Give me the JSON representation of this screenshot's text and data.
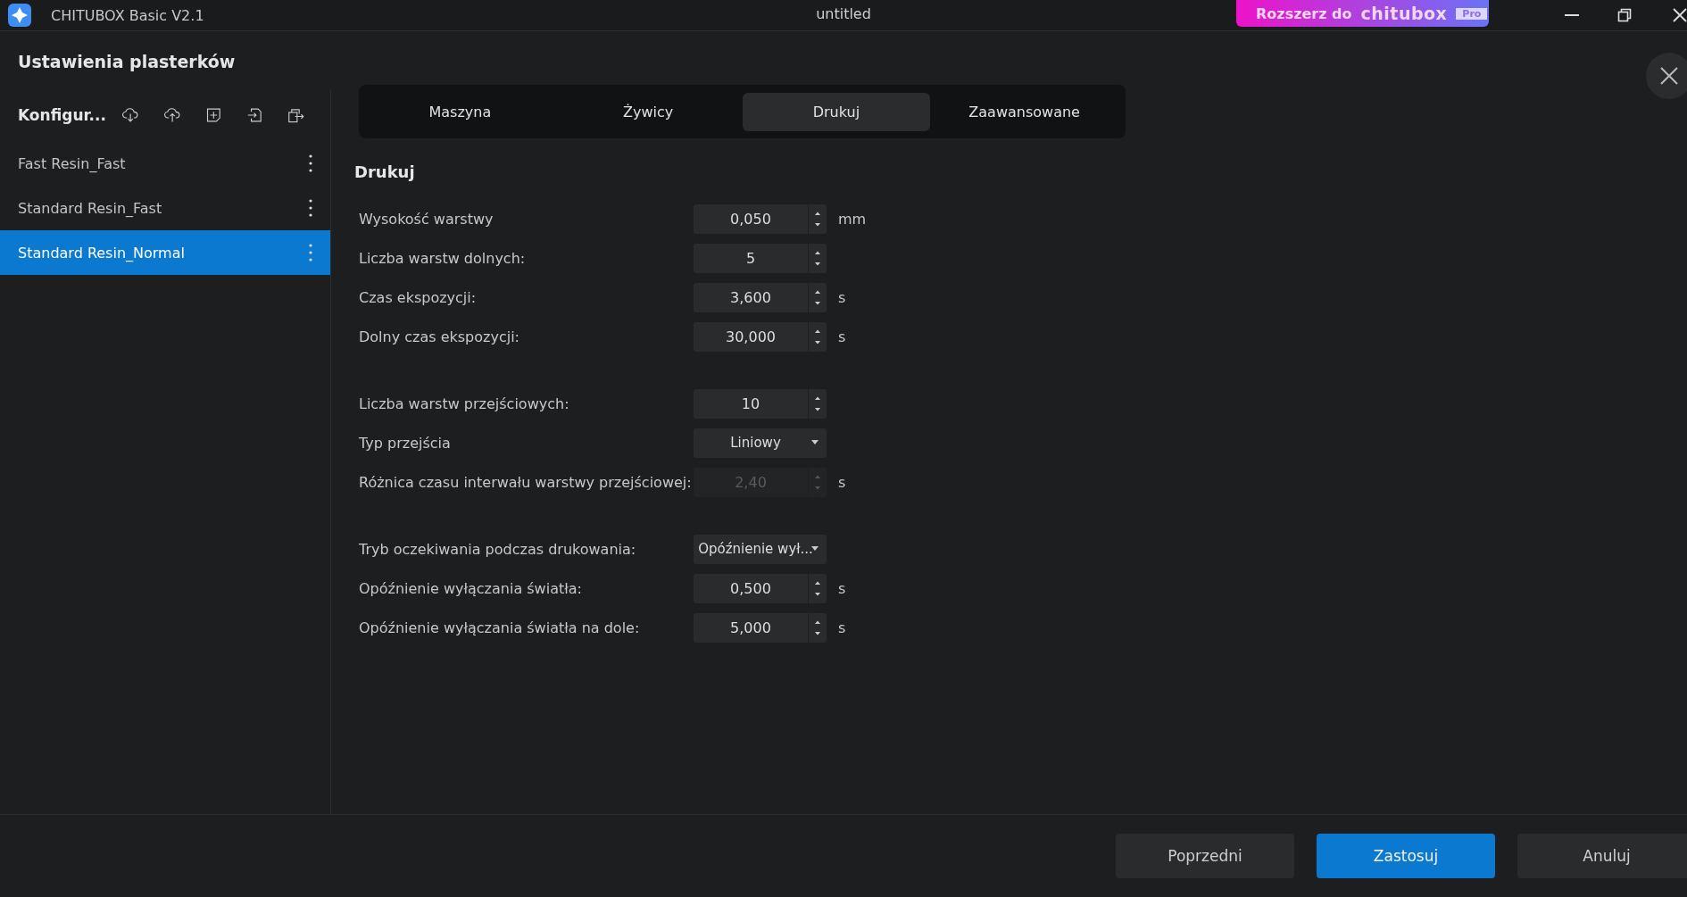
{
  "window": {
    "app_title": "CHITUBOX Basic V2.1",
    "document_title": "untitled",
    "upgrade_banner": {
      "label": "Rozszerz do",
      "brand": "chitubox",
      "badge": "Pro"
    }
  },
  "dialog": {
    "title": "Ustawienia plasterków"
  },
  "sidebar": {
    "heading": "Konfigur...",
    "items": [
      {
        "label": "Fast Resin_Fast",
        "selected": false
      },
      {
        "label": "Standard Resin_Fast",
        "selected": false
      },
      {
        "label": "Standard Resin_Normal",
        "selected": true
      }
    ]
  },
  "tabs": [
    {
      "label": "Maszyna",
      "selected": false
    },
    {
      "label": "Żywicy",
      "selected": false
    },
    {
      "label": "Drukuj",
      "selected": true
    },
    {
      "label": "Zaawansowane",
      "selected": false
    }
  ],
  "section": {
    "title": "Drukuj",
    "groups": [
      [
        {
          "kind": "spin",
          "label": "Wysokość warstwy",
          "value": "0,050",
          "unit": "mm",
          "disabled": false
        },
        {
          "kind": "spin",
          "label": "Liczba warstw dolnych:",
          "value": "5",
          "disabled": false
        },
        {
          "kind": "spin",
          "label": "Czas ekspozycji:",
          "value": "3,600",
          "unit": "s",
          "disabled": false
        },
        {
          "kind": "spin",
          "label": "Dolny czas ekspozycji:",
          "value": "30,000",
          "unit": "s",
          "disabled": false
        }
      ],
      [
        {
          "kind": "spin",
          "label": "Liczba warstw przejściowych:",
          "value": "10",
          "disabled": false
        },
        {
          "kind": "dropdown",
          "label": "Typ przejścia",
          "value": "Liniowy",
          "disabled": false
        },
        {
          "kind": "spin",
          "label": "Różnica czasu interwału warstwy przejściowej:",
          "value": "2,40",
          "unit": "s",
          "disabled": true
        }
      ],
      [
        {
          "kind": "dropdown",
          "label": "Tryb oczekiwania podczas drukowania:",
          "value": "Opóźnienie wył...",
          "disabled": false
        },
        {
          "kind": "spin",
          "label": "Opóźnienie wyłączania światła:",
          "value": "0,500",
          "unit": "s",
          "disabled": false
        },
        {
          "kind": "spin",
          "label": "Opóźnienie wyłączania światła na dole:",
          "value": "5,000",
          "unit": "s",
          "disabled": false
        }
      ]
    ]
  },
  "buttons": [
    {
      "label": "Poprzedni",
      "primary": false
    },
    {
      "label": "Zastosuj",
      "primary": true
    },
    {
      "label": "Anuluj",
      "primary": false
    }
  ]
}
